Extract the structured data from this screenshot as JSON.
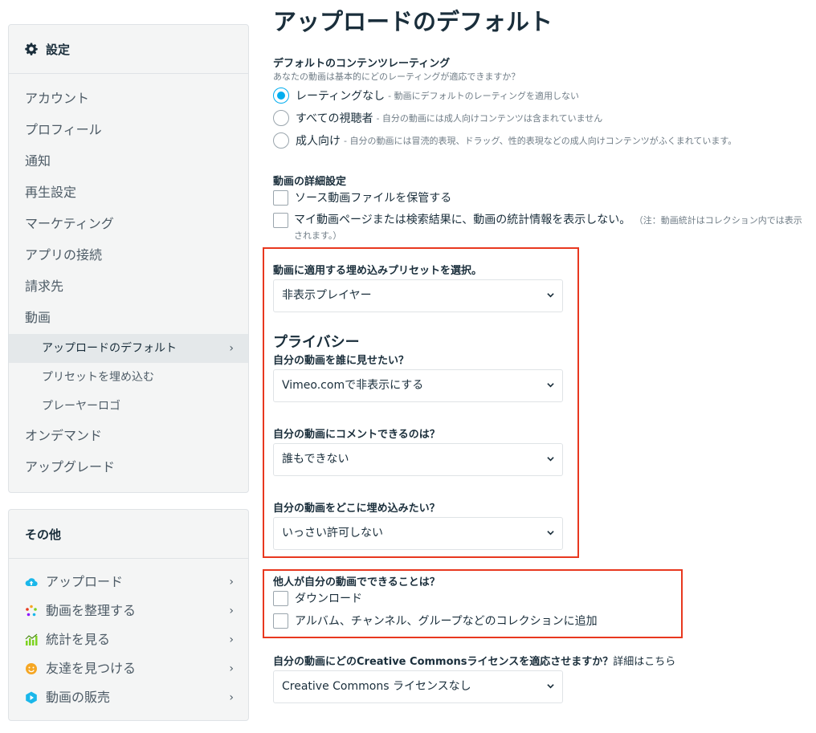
{
  "sidebar": {
    "settings_title": "設定",
    "items": [
      {
        "label": "アカウント"
      },
      {
        "label": "プロフィール"
      },
      {
        "label": "通知"
      },
      {
        "label": "再生設定"
      },
      {
        "label": "マーケティング"
      },
      {
        "label": "アプリの接続"
      },
      {
        "label": "請求先"
      },
      {
        "label": "動画"
      },
      {
        "label": "アップロードのデフォルト",
        "sub": true,
        "active": true
      },
      {
        "label": "プリセットを埋め込む",
        "sub": true
      },
      {
        "label": "プレーヤーロゴ",
        "sub": true
      },
      {
        "label": "オンデマンド"
      },
      {
        "label": "アップグレード"
      }
    ],
    "other_title": "その他",
    "other_items": [
      {
        "label": "アップロード",
        "icon": "cloud-upload-icon"
      },
      {
        "label": "動画を整理する",
        "icon": "organize-icon"
      },
      {
        "label": "統計を見る",
        "icon": "stats-icon"
      },
      {
        "label": "友達を見つける",
        "icon": "smiley-icon"
      },
      {
        "label": "動画の販売",
        "icon": "sell-icon"
      }
    ],
    "chevron": "›"
  },
  "main": {
    "title": "アップロードのデフォルト",
    "rating": {
      "label": "デフォルトのコンテンツレーティング",
      "hint": "あなたの動画は基本的にどのレーティングが適応できますか？",
      "options": [
        {
          "label": "レーティングなし",
          "desc": "- 動画にデフォルトのレーティングを適用しない",
          "checked": true
        },
        {
          "label": "すべての視聴者",
          "desc": "- 自分の動画には成人向けコンテンツは含まれていません",
          "checked": false
        },
        {
          "label": "成人向け",
          "desc": "- 自分の動画には冒涜的表現、ドラッグ、性的表現などの成人向けコンテンツがふくまれています。",
          "checked": false
        }
      ]
    },
    "details": {
      "label": "動画の詳細設定",
      "keep_source": "ソース動画ファイルを保管する",
      "hide_stats": "マイ動画ページまたは検索結果に、動画の統計情報を表示しない。",
      "hide_stats_note": "（注：動画統計はコレクション内では表示されます。）"
    },
    "embed_preset": {
      "label": "動画に適用する埋め込みプリセットを選択。",
      "value": "非表示プレイヤー"
    },
    "privacy": {
      "title": "プライバシー",
      "who_view_label": "自分の動画を誰に見せたい？",
      "who_view_value": "Vimeo.comで非表示にする",
      "who_comment_label": "自分の動画にコメントできるのは？",
      "who_comment_value": "誰もできない",
      "where_embed_label": "自分の動画をどこに埋め込みたい？",
      "where_embed_value": "いっさい許可しない"
    },
    "others_can": {
      "label": "他人が自分の動画でできることは？",
      "download": "ダウンロード",
      "add_collections": "アルバム、チャンネル、グループなどのコレクションに追加"
    },
    "cc": {
      "label": "自分の動画にどのCreative Commonsライセンスを適応させますか？",
      "link": "詳細はこちら",
      "value": "Creative Commons ライセンスなし"
    }
  },
  "colors": {
    "accent": "#00adef",
    "highlight": "#e8381f",
    "text": "#1a2e3b",
    "muted": "#6f7c86"
  }
}
